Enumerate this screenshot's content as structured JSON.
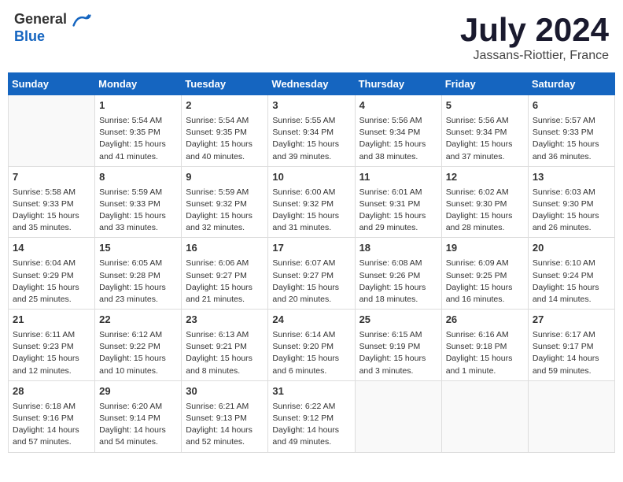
{
  "header": {
    "logo_general": "General",
    "logo_blue": "Blue",
    "month_title": "July 2024",
    "location": "Jassans-Riottier, France"
  },
  "days_of_week": [
    "Sunday",
    "Monday",
    "Tuesday",
    "Wednesday",
    "Thursday",
    "Friday",
    "Saturday"
  ],
  "weeks": [
    [
      {
        "day": "",
        "info": ""
      },
      {
        "day": "1",
        "info": "Sunrise: 5:54 AM\nSunset: 9:35 PM\nDaylight: 15 hours\nand 41 minutes."
      },
      {
        "day": "2",
        "info": "Sunrise: 5:54 AM\nSunset: 9:35 PM\nDaylight: 15 hours\nand 40 minutes."
      },
      {
        "day": "3",
        "info": "Sunrise: 5:55 AM\nSunset: 9:34 PM\nDaylight: 15 hours\nand 39 minutes."
      },
      {
        "day": "4",
        "info": "Sunrise: 5:56 AM\nSunset: 9:34 PM\nDaylight: 15 hours\nand 38 minutes."
      },
      {
        "day": "5",
        "info": "Sunrise: 5:56 AM\nSunset: 9:34 PM\nDaylight: 15 hours\nand 37 minutes."
      },
      {
        "day": "6",
        "info": "Sunrise: 5:57 AM\nSunset: 9:33 PM\nDaylight: 15 hours\nand 36 minutes."
      }
    ],
    [
      {
        "day": "7",
        "info": "Sunrise: 5:58 AM\nSunset: 9:33 PM\nDaylight: 15 hours\nand 35 minutes."
      },
      {
        "day": "8",
        "info": "Sunrise: 5:59 AM\nSunset: 9:33 PM\nDaylight: 15 hours\nand 33 minutes."
      },
      {
        "day": "9",
        "info": "Sunrise: 5:59 AM\nSunset: 9:32 PM\nDaylight: 15 hours\nand 32 minutes."
      },
      {
        "day": "10",
        "info": "Sunrise: 6:00 AM\nSunset: 9:32 PM\nDaylight: 15 hours\nand 31 minutes."
      },
      {
        "day": "11",
        "info": "Sunrise: 6:01 AM\nSunset: 9:31 PM\nDaylight: 15 hours\nand 29 minutes."
      },
      {
        "day": "12",
        "info": "Sunrise: 6:02 AM\nSunset: 9:30 PM\nDaylight: 15 hours\nand 28 minutes."
      },
      {
        "day": "13",
        "info": "Sunrise: 6:03 AM\nSunset: 9:30 PM\nDaylight: 15 hours\nand 26 minutes."
      }
    ],
    [
      {
        "day": "14",
        "info": "Sunrise: 6:04 AM\nSunset: 9:29 PM\nDaylight: 15 hours\nand 25 minutes."
      },
      {
        "day": "15",
        "info": "Sunrise: 6:05 AM\nSunset: 9:28 PM\nDaylight: 15 hours\nand 23 minutes."
      },
      {
        "day": "16",
        "info": "Sunrise: 6:06 AM\nSunset: 9:27 PM\nDaylight: 15 hours\nand 21 minutes."
      },
      {
        "day": "17",
        "info": "Sunrise: 6:07 AM\nSunset: 9:27 PM\nDaylight: 15 hours\nand 20 minutes."
      },
      {
        "day": "18",
        "info": "Sunrise: 6:08 AM\nSunset: 9:26 PM\nDaylight: 15 hours\nand 18 minutes."
      },
      {
        "day": "19",
        "info": "Sunrise: 6:09 AM\nSunset: 9:25 PM\nDaylight: 15 hours\nand 16 minutes."
      },
      {
        "day": "20",
        "info": "Sunrise: 6:10 AM\nSunset: 9:24 PM\nDaylight: 15 hours\nand 14 minutes."
      }
    ],
    [
      {
        "day": "21",
        "info": "Sunrise: 6:11 AM\nSunset: 9:23 PM\nDaylight: 15 hours\nand 12 minutes."
      },
      {
        "day": "22",
        "info": "Sunrise: 6:12 AM\nSunset: 9:22 PM\nDaylight: 15 hours\nand 10 minutes."
      },
      {
        "day": "23",
        "info": "Sunrise: 6:13 AM\nSunset: 9:21 PM\nDaylight: 15 hours\nand 8 minutes."
      },
      {
        "day": "24",
        "info": "Sunrise: 6:14 AM\nSunset: 9:20 PM\nDaylight: 15 hours\nand 6 minutes."
      },
      {
        "day": "25",
        "info": "Sunrise: 6:15 AM\nSunset: 9:19 PM\nDaylight: 15 hours\nand 3 minutes."
      },
      {
        "day": "26",
        "info": "Sunrise: 6:16 AM\nSunset: 9:18 PM\nDaylight: 15 hours\nand 1 minute."
      },
      {
        "day": "27",
        "info": "Sunrise: 6:17 AM\nSunset: 9:17 PM\nDaylight: 14 hours\nand 59 minutes."
      }
    ],
    [
      {
        "day": "28",
        "info": "Sunrise: 6:18 AM\nSunset: 9:16 PM\nDaylight: 14 hours\nand 57 minutes."
      },
      {
        "day": "29",
        "info": "Sunrise: 6:20 AM\nSunset: 9:14 PM\nDaylight: 14 hours\nand 54 minutes."
      },
      {
        "day": "30",
        "info": "Sunrise: 6:21 AM\nSunset: 9:13 PM\nDaylight: 14 hours\nand 52 minutes."
      },
      {
        "day": "31",
        "info": "Sunrise: 6:22 AM\nSunset: 9:12 PM\nDaylight: 14 hours\nand 49 minutes."
      },
      {
        "day": "",
        "info": ""
      },
      {
        "day": "",
        "info": ""
      },
      {
        "day": "",
        "info": ""
      }
    ]
  ]
}
